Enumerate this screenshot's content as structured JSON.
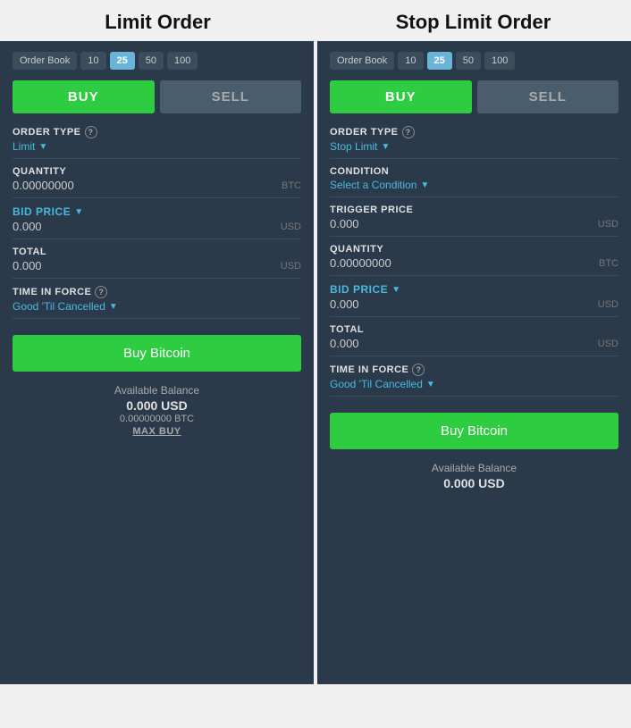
{
  "titles": {
    "limit_order": "Limit Order",
    "stop_limit_order": "Stop Limit Order"
  },
  "orderbook": {
    "label": "Order Book",
    "options": [
      "10",
      "25",
      "50",
      "100"
    ],
    "active": "25"
  },
  "buttons": {
    "buy": "BUY",
    "sell": "SELL",
    "buy_bitcoin": "Buy Bitcoin"
  },
  "limit_panel": {
    "order_type_label": "ORDER TYPE",
    "order_type_value": "Limit",
    "quantity_label": "QUANTITY",
    "quantity_value": "0.00000000",
    "quantity_unit": "BTC",
    "bid_price_label": "BID PRICE",
    "bid_price_value": "0.000",
    "bid_price_unit": "USD",
    "total_label": "TOTAL",
    "total_value": "0.000",
    "total_unit": "USD",
    "time_in_force_label": "TIME IN FORCE",
    "time_in_force_value": "Good 'Til Cancelled",
    "available_balance": "Available Balance",
    "balance_usd": "0.000  USD",
    "balance_btc": "0.00000000  BTC",
    "max_buy": "MAX BUY"
  },
  "stop_limit_panel": {
    "order_type_label": "ORDER TYPE",
    "order_type_value": "Stop Limit",
    "condition_label": "CONDITION",
    "condition_value": "Select a Condition",
    "trigger_price_label": "TRIGGER PRICE",
    "trigger_price_value": "0.000",
    "trigger_price_unit": "USD",
    "quantity_label": "QUANTITY",
    "quantity_value": "0.00000000",
    "quantity_unit": "BTC",
    "bid_price_label": "BID PRICE",
    "bid_price_value": "0.000",
    "bid_price_unit": "USD",
    "total_label": "TOTAL",
    "total_value": "0.000",
    "total_unit": "USD",
    "time_in_force_label": "TIME IN FORCE",
    "time_in_force_value": "Good 'Til Cancelled",
    "available_balance": "Available Balance",
    "balance_usd": "0.000  USD"
  }
}
